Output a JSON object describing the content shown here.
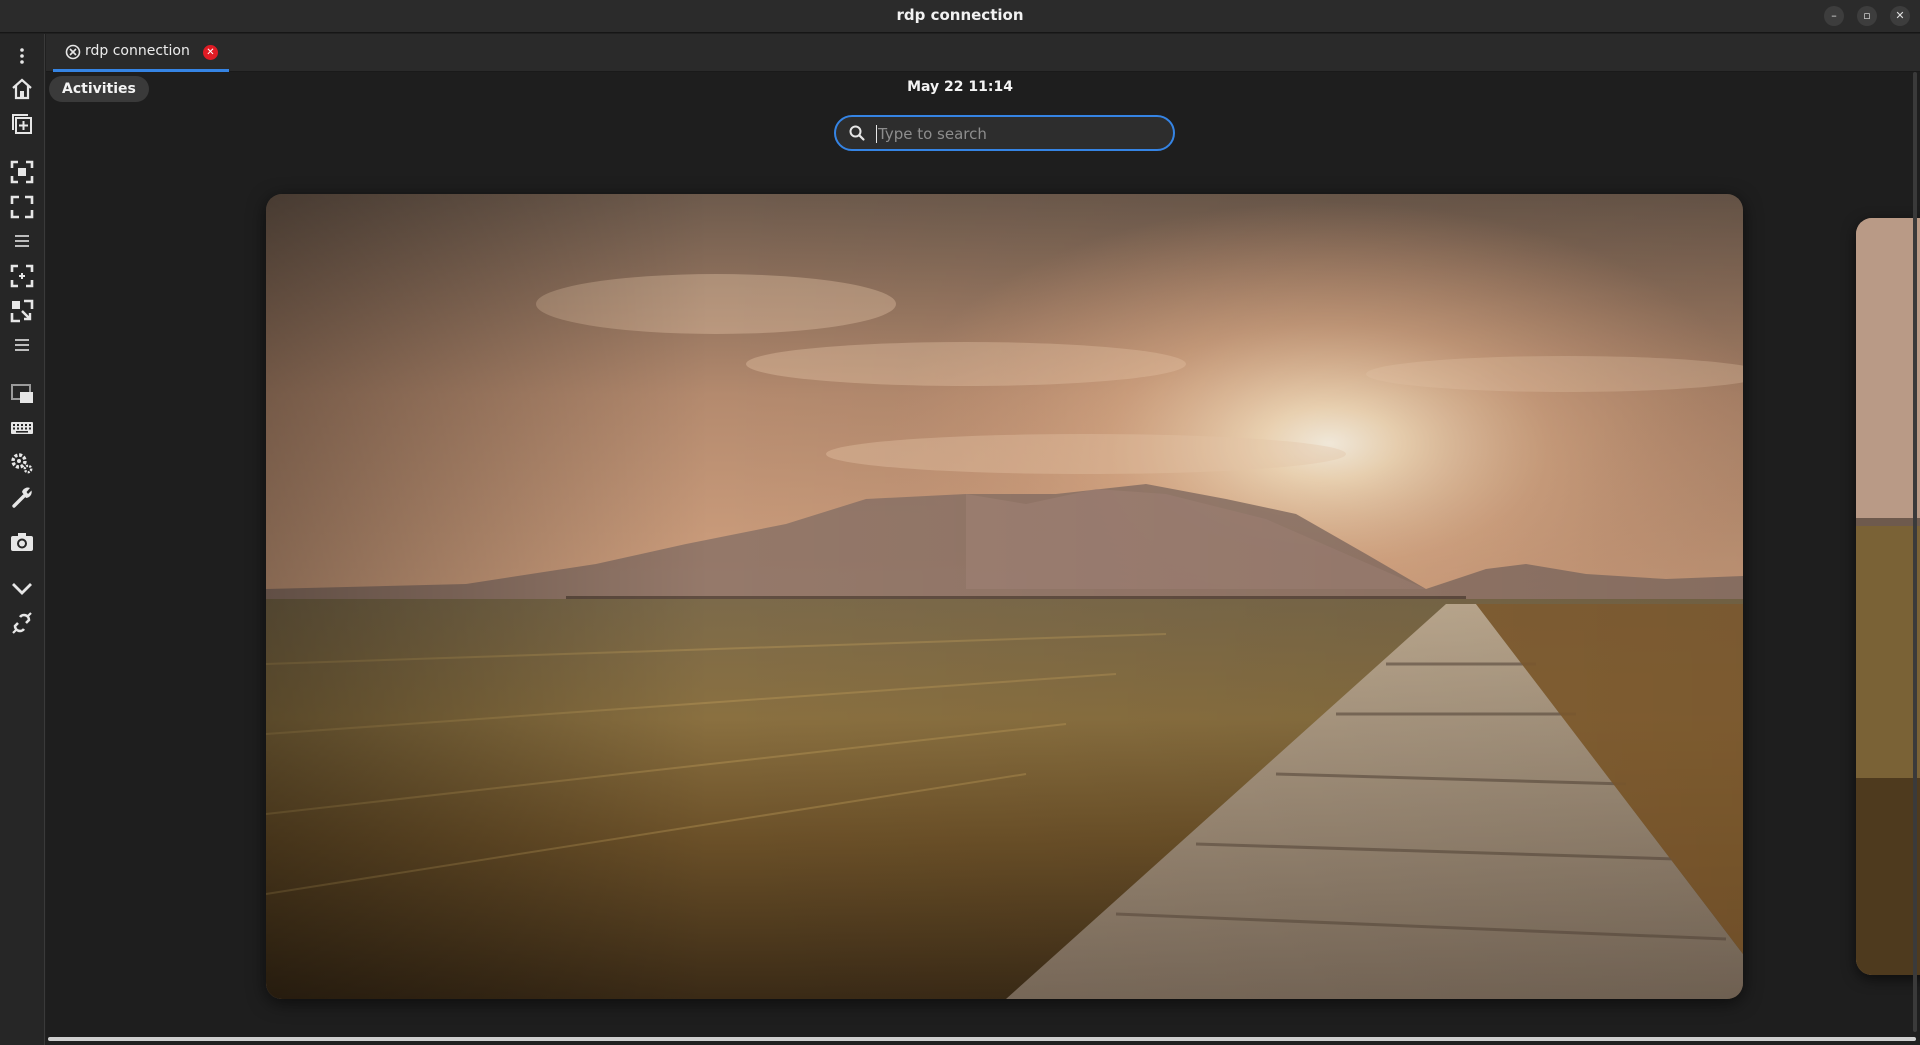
{
  "window": {
    "title": "rdp connection",
    "controls": {
      "minimize": "–",
      "maximize": "▫",
      "close": "✕"
    }
  },
  "tab": {
    "label": "rdp connection",
    "close_glyph": "✕"
  },
  "toolbar": {
    "icons": [
      "menu-kebab-icon",
      "home-icon",
      "new-connection-icon",
      "fit-window-icon",
      "fullscreen-icon",
      "menu-lines-icon",
      "scale-icon",
      "dynamic-resolution-icon",
      "menu-lines-icon",
      "multi-monitor-icon",
      "keyboard-icon",
      "preferences-icon",
      "tools-icon",
      "screenshot-icon",
      "minimize-toolbar-icon",
      "disconnect-icon"
    ]
  },
  "remote": {
    "activities_label": "Activities",
    "clock": "May 22  11:14",
    "search": {
      "placeholder": "Type to search",
      "value": ""
    }
  },
  "colors": {
    "accent": "#3584e4",
    "close_red": "#e01b24",
    "background": "#1e1e1e"
  }
}
